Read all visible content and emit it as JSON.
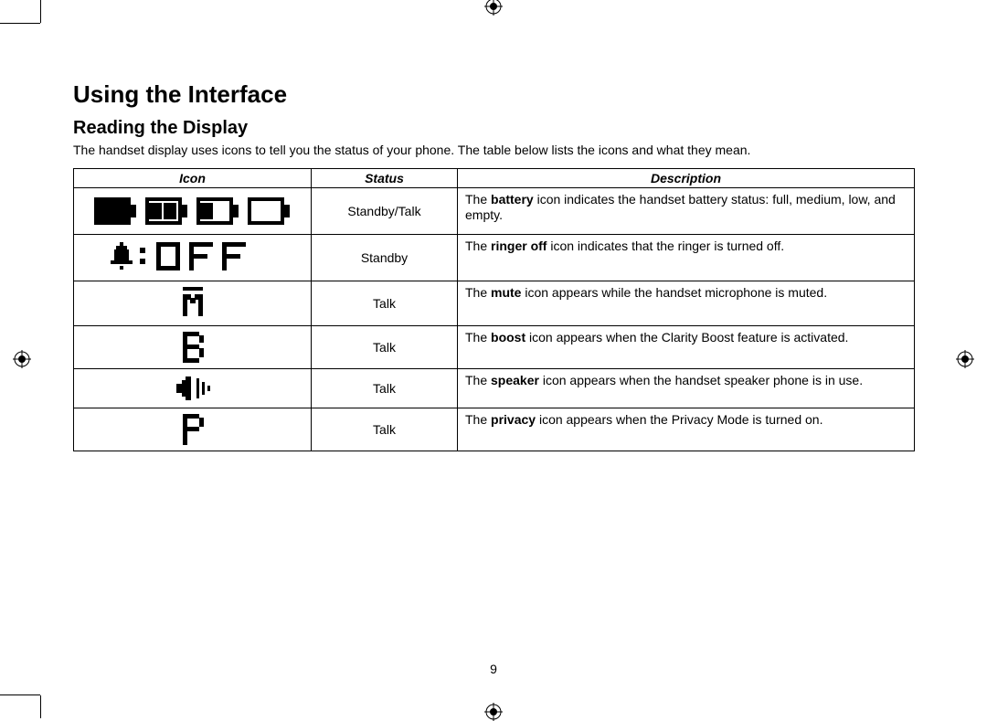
{
  "heading": "Using the Interface",
  "subheading": "Reading the Display",
  "intro": "The handset display uses icons to tell you the status of your phone. The table below lists the icons and what they mean.",
  "table": {
    "headers": {
      "icon": "Icon",
      "status": "Status",
      "description": "Description"
    },
    "rows": [
      {
        "icon_name": "battery-levels-icon",
        "status": "Standby/Talk",
        "desc_pre": "The ",
        "desc_bold": "battery",
        "desc_post": " icon indicates the handset battery status: full, medium, low, and empty."
      },
      {
        "icon_name": "ringer-off-icon",
        "status": "Standby",
        "desc_pre": "The ",
        "desc_bold": "ringer off",
        "desc_post": " icon indicates that the ringer is turned off."
      },
      {
        "icon_name": "mute-icon",
        "status": "Talk",
        "desc_pre": "The ",
        "desc_bold": "mute",
        "desc_post": " icon appears while the handset microphone is muted."
      },
      {
        "icon_name": "boost-icon",
        "status": "Talk",
        "desc_pre": "The ",
        "desc_bold": "boost",
        "desc_post": " icon appears when the Clarity Boost feature is activated."
      },
      {
        "icon_name": "speaker-icon",
        "status": "Talk",
        "desc_pre": "The ",
        "desc_bold": "speaker",
        "desc_post": " icon appears when the handset speaker phone is in use."
      },
      {
        "icon_name": "privacy-icon",
        "status": "Talk",
        "desc_pre": "The ",
        "desc_bold": "privacy",
        "desc_post": " icon appears when the Privacy Mode is turned on."
      }
    ]
  },
  "page_number": "9"
}
